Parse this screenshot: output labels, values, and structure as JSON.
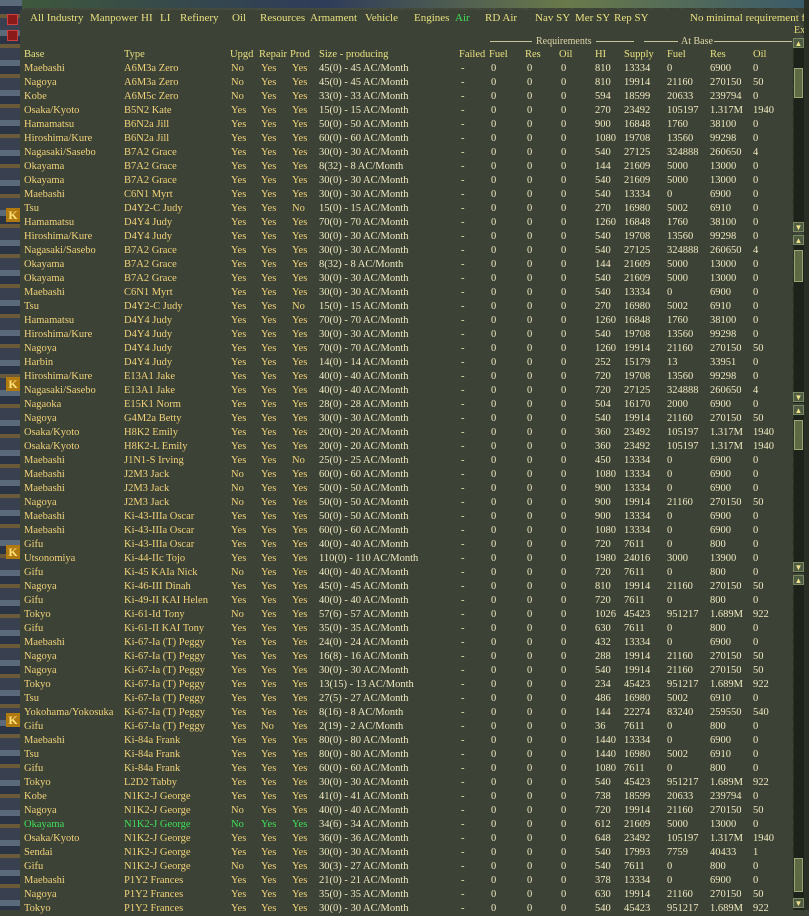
{
  "filters": [
    {
      "label": "All Industry",
      "active": false
    },
    {
      "label": "Manpower",
      "active": false
    },
    {
      "label": "HI",
      "active": false
    },
    {
      "label": "LI",
      "active": false
    },
    {
      "label": "Refinery",
      "active": false
    },
    {
      "label": "Oil",
      "active": false
    },
    {
      "label": "Resources",
      "active": false
    },
    {
      "label": "Armament",
      "active": false
    },
    {
      "label": "Vehicle",
      "active": false
    },
    {
      "label": "Engines",
      "active": false
    },
    {
      "label": "Air",
      "active": true
    },
    {
      "label": "RD Air",
      "active": false
    },
    {
      "label": "Nav SY",
      "active": false
    },
    {
      "label": "Mer SY",
      "active": false
    },
    {
      "label": "Rep SY",
      "active": false
    },
    {
      "label": "No minimal requirement fil",
      "active": false
    }
  ],
  "corner_label": "Ex",
  "group_headers": {
    "requirements": "Requirements",
    "at_base": "At Base"
  },
  "columns": [
    "Base",
    "Type",
    "Upgd",
    "Repair",
    "Prod",
    "Size - producing",
    "Failed",
    "Fuel",
    "Res",
    "Oil",
    "HI",
    "Supply",
    "Fuel",
    "Res",
    "Oil"
  ],
  "rows": [
    [
      "Maebashi",
      "A6M3a Zero",
      "No",
      "Yes",
      "Yes",
      "45(0) - 45 AC/Month",
      "-",
      "0",
      "0",
      "0",
      "810",
      "13334",
      "0",
      "6900",
      "0"
    ],
    [
      "Nagoya",
      "A6M3a Zero",
      "No",
      "Yes",
      "Yes",
      "45(0) - 45 AC/Month",
      "-",
      "0",
      "0",
      "0",
      "810",
      "19914",
      "21160",
      "270150",
      "50"
    ],
    [
      "Kobe",
      "A6M5c Zero",
      "No",
      "Yes",
      "Yes",
      "33(0) - 33 AC/Month",
      "-",
      "0",
      "0",
      "0",
      "594",
      "18599",
      "20633",
      "239794",
      "0"
    ],
    [
      "Osaka/Kyoto",
      "B5N2 Kate",
      "Yes",
      "Yes",
      "Yes",
      "15(0) - 15 AC/Month",
      "-",
      "0",
      "0",
      "0",
      "270",
      "23492",
      "105197",
      "1.317M",
      "1940"
    ],
    [
      "Hamamatsu",
      "B6N2a Jill",
      "Yes",
      "Yes",
      "Yes",
      "50(0) - 50 AC/Month",
      "-",
      "0",
      "0",
      "0",
      "900",
      "16848",
      "1760",
      "38100",
      "0"
    ],
    [
      "Hiroshima/Kure",
      "B6N2a Jill",
      "Yes",
      "Yes",
      "Yes",
      "60(0) - 60 AC/Month",
      "-",
      "0",
      "0",
      "0",
      "1080",
      "19708",
      "13560",
      "99298",
      "0"
    ],
    [
      "Nagasaki/Sasebo",
      "B7A2 Grace",
      "Yes",
      "Yes",
      "Yes",
      "30(0) - 30 AC/Month",
      "-",
      "0",
      "0",
      "0",
      "540",
      "27125",
      "324888",
      "260650",
      "4"
    ],
    [
      "Okayama",
      "B7A2 Grace",
      "Yes",
      "Yes",
      "Yes",
      "8(32) - 8 AC/Month",
      "-",
      "0",
      "0",
      "0",
      "144",
      "21609",
      "5000",
      "13000",
      "0"
    ],
    [
      "Okayama",
      "B7A2 Grace",
      "Yes",
      "Yes",
      "Yes",
      "30(0) - 30 AC/Month",
      "-",
      "0",
      "0",
      "0",
      "540",
      "21609",
      "5000",
      "13000",
      "0"
    ],
    [
      "Maebashi",
      "C6N1 Myrt",
      "Yes",
      "Yes",
      "Yes",
      "30(0) - 30 AC/Month",
      "-",
      "0",
      "0",
      "0",
      "540",
      "13334",
      "0",
      "6900",
      "0"
    ],
    [
      "Tsu",
      "D4Y2-C Judy",
      "Yes",
      "Yes",
      "No",
      "15(0) - 15 AC/Month",
      "-",
      "0",
      "0",
      "0",
      "270",
      "16980",
      "5002",
      "6910",
      "0"
    ],
    [
      "Hamamatsu",
      "D4Y4 Judy",
      "Yes",
      "Yes",
      "Yes",
      "70(0) - 70 AC/Month",
      "-",
      "0",
      "0",
      "0",
      "1260",
      "16848",
      "1760",
      "38100",
      "0"
    ],
    [
      "Hiroshima/Kure",
      "D4Y4 Judy",
      "Yes",
      "Yes",
      "Yes",
      "30(0) - 30 AC/Month",
      "-",
      "0",
      "0",
      "0",
      "540",
      "19708",
      "13560",
      "99298",
      "0"
    ],
    [
      "Nagasaki/Sasebo",
      "B7A2 Grace",
      "Yes",
      "Yes",
      "Yes",
      "30(0) - 30 AC/Month",
      "-",
      "0",
      "0",
      "0",
      "540",
      "27125",
      "324888",
      "260650",
      "4"
    ],
    [
      "Okayama",
      "B7A2 Grace",
      "Yes",
      "Yes",
      "Yes",
      "8(32) - 8 AC/Month",
      "-",
      "0",
      "0",
      "0",
      "144",
      "21609",
      "5000",
      "13000",
      "0"
    ],
    [
      "Okayama",
      "B7A2 Grace",
      "Yes",
      "Yes",
      "Yes",
      "30(0) - 30 AC/Month",
      "-",
      "0",
      "0",
      "0",
      "540",
      "21609",
      "5000",
      "13000",
      "0"
    ],
    [
      "Maebashi",
      "C6N1 Myrt",
      "Yes",
      "Yes",
      "Yes",
      "30(0) - 30 AC/Month",
      "-",
      "0",
      "0",
      "0",
      "540",
      "13334",
      "0",
      "6900",
      "0"
    ],
    [
      "Tsu",
      "D4Y2-C Judy",
      "Yes",
      "Yes",
      "No",
      "15(0) - 15 AC/Month",
      "-",
      "0",
      "0",
      "0",
      "270",
      "16980",
      "5002",
      "6910",
      "0"
    ],
    [
      "Hamamatsu",
      "D4Y4 Judy",
      "Yes",
      "Yes",
      "Yes",
      "70(0) - 70 AC/Month",
      "-",
      "0",
      "0",
      "0",
      "1260",
      "16848",
      "1760",
      "38100",
      "0"
    ],
    [
      "Hiroshima/Kure",
      "D4Y4 Judy",
      "Yes",
      "Yes",
      "Yes",
      "30(0) - 30 AC/Month",
      "-",
      "0",
      "0",
      "0",
      "540",
      "19708",
      "13560",
      "99298",
      "0"
    ],
    [
      "Nagoya",
      "D4Y4 Judy",
      "Yes",
      "Yes",
      "Yes",
      "70(0) - 70 AC/Month",
      "-",
      "0",
      "0",
      "0",
      "1260",
      "19914",
      "21160",
      "270150",
      "50"
    ],
    [
      "Harbin",
      "D4Y4 Judy",
      "Yes",
      "Yes",
      "Yes",
      "14(0) - 14 AC/Month",
      "-",
      "0",
      "0",
      "0",
      "252",
      "15179",
      "13",
      "33951",
      "0"
    ],
    [
      "Hiroshima/Kure",
      "E13A1 Jake",
      "Yes",
      "Yes",
      "Yes",
      "40(0) - 40 AC/Month",
      "-",
      "0",
      "0",
      "0",
      "720",
      "19708",
      "13560",
      "99298",
      "0"
    ],
    [
      "Nagasaki/Sasebo",
      "E13A1 Jake",
      "Yes",
      "Yes",
      "Yes",
      "40(0) - 40 AC/Month",
      "-",
      "0",
      "0",
      "0",
      "720",
      "27125",
      "324888",
      "260650",
      "4"
    ],
    [
      "Nagaoka",
      "E15K1 Norm",
      "Yes",
      "Yes",
      "Yes",
      "28(0) - 28 AC/Month",
      "-",
      "0",
      "0",
      "0",
      "504",
      "16170",
      "2000",
      "6900",
      "0"
    ],
    [
      "Nagoya",
      "G4M2a Betty",
      "Yes",
      "Yes",
      "Yes",
      "30(0) - 30 AC/Month",
      "-",
      "0",
      "0",
      "0",
      "540",
      "19914",
      "21160",
      "270150",
      "50"
    ],
    [
      "Osaka/Kyoto",
      "H8K2 Emily",
      "Yes",
      "Yes",
      "Yes",
      "20(0) - 20 AC/Month",
      "-",
      "0",
      "0",
      "0",
      "360",
      "23492",
      "105197",
      "1.317M",
      "1940"
    ],
    [
      "Osaka/Kyoto",
      "H8K2-L Emily",
      "Yes",
      "Yes",
      "Yes",
      "20(0) - 20 AC/Month",
      "-",
      "0",
      "0",
      "0",
      "360",
      "23492",
      "105197",
      "1.317M",
      "1940"
    ],
    [
      "Maebashi",
      "J1N1-S Irving",
      "Yes",
      "Yes",
      "No",
      "25(0) - 25 AC/Month",
      "-",
      "0",
      "0",
      "0",
      "450",
      "13334",
      "0",
      "6900",
      "0"
    ],
    [
      "Maebashi",
      "J2M3 Jack",
      "No",
      "Yes",
      "Yes",
      "60(0) - 60 AC/Month",
      "-",
      "0",
      "0",
      "0",
      "1080",
      "13334",
      "0",
      "6900",
      "0"
    ],
    [
      "Maebashi",
      "J2M3 Jack",
      "No",
      "Yes",
      "Yes",
      "50(0) - 50 AC/Month",
      "-",
      "0",
      "0",
      "0",
      "900",
      "13334",
      "0",
      "6900",
      "0"
    ],
    [
      "Nagoya",
      "J2M3 Jack",
      "No",
      "Yes",
      "Yes",
      "50(0) - 50 AC/Month",
      "-",
      "0",
      "0",
      "0",
      "900",
      "19914",
      "21160",
      "270150",
      "50"
    ],
    [
      "Maebashi",
      "Ki-43-IIIa Oscar",
      "Yes",
      "Yes",
      "Yes",
      "50(0) - 50 AC/Month",
      "-",
      "0",
      "0",
      "0",
      "900",
      "13334",
      "0",
      "6900",
      "0"
    ],
    [
      "Maebashi",
      "Ki-43-IIIa Oscar",
      "Yes",
      "Yes",
      "Yes",
      "60(0) - 60 AC/Month",
      "-",
      "0",
      "0",
      "0",
      "1080",
      "13334",
      "0",
      "6900",
      "0"
    ],
    [
      "Gifu",
      "Ki-43-IIIa Oscar",
      "Yes",
      "Yes",
      "Yes",
      "40(0) - 40 AC/Month",
      "-",
      "0",
      "0",
      "0",
      "720",
      "7611",
      "0",
      "800",
      "0"
    ],
    [
      "Utsonomiya",
      "Ki-44-IIc Tojo",
      "Yes",
      "Yes",
      "Yes",
      "110(0) - 110 AC/Month",
      "-",
      "0",
      "0",
      "0",
      "1980",
      "24016",
      "3000",
      "13900",
      "0"
    ],
    [
      "Gifu",
      "Ki-45 KAIa Nick",
      "No",
      "Yes",
      "Yes",
      "40(0) - 40 AC/Month",
      "-",
      "0",
      "0",
      "0",
      "720",
      "7611",
      "0",
      "800",
      "0"
    ],
    [
      "Nagoya",
      "Ki-46-III Dinah",
      "Yes",
      "Yes",
      "Yes",
      "45(0) - 45 AC/Month",
      "-",
      "0",
      "0",
      "0",
      "810",
      "19914",
      "21160",
      "270150",
      "50"
    ],
    [
      "Gifu",
      "Ki-49-II KAI Helen",
      "Yes",
      "Yes",
      "Yes",
      "40(0) - 40 AC/Month",
      "-",
      "0",
      "0",
      "0",
      "720",
      "7611",
      "0",
      "800",
      "0"
    ],
    [
      "Tokyo",
      "Ki-61-Id Tony",
      "No",
      "Yes",
      "Yes",
      "57(6) - 57 AC/Month",
      "-",
      "0",
      "0",
      "0",
      "1026",
      "45423",
      "951217",
      "1.689M",
      "922"
    ],
    [
      "Gifu",
      "Ki-61-II KAI Tony",
      "Yes",
      "Yes",
      "Yes",
      "35(0) - 35 AC/Month",
      "-",
      "0",
      "0",
      "0",
      "630",
      "7611",
      "0",
      "800",
      "0"
    ],
    [
      "Maebashi",
      "Ki-67-Ia (T) Peggy",
      "Yes",
      "Yes",
      "Yes",
      "24(0) - 24 AC/Month",
      "-",
      "0",
      "0",
      "0",
      "432",
      "13334",
      "0",
      "6900",
      "0"
    ],
    [
      "Nagoya",
      "Ki-67-Ia (T) Peggy",
      "Yes",
      "Yes",
      "Yes",
      "16(8) - 16 AC/Month",
      "-",
      "0",
      "0",
      "0",
      "288",
      "19914",
      "21160",
      "270150",
      "50"
    ],
    [
      "Nagoya",
      "Ki-67-Ia (T) Peggy",
      "Yes",
      "Yes",
      "Yes",
      "30(0) - 30 AC/Month",
      "-",
      "0",
      "0",
      "0",
      "540",
      "19914",
      "21160",
      "270150",
      "50"
    ],
    [
      "Tokyo",
      "Ki-67-Ia (T) Peggy",
      "Yes",
      "Yes",
      "Yes",
      "13(15) - 13 AC/Month",
      "-",
      "0",
      "0",
      "0",
      "234",
      "45423",
      "951217",
      "1.689M",
      "922"
    ],
    [
      "Tsu",
      "Ki-67-Ia (T) Peggy",
      "Yes",
      "Yes",
      "Yes",
      "27(5) - 27 AC/Month",
      "-",
      "0",
      "0",
      "0",
      "486",
      "16980",
      "5002",
      "6910",
      "0"
    ],
    [
      "Yokohama/Yokosuka",
      "Ki-67-Ia (T) Peggy",
      "Yes",
      "Yes",
      "Yes",
      "8(16) - 8 AC/Month",
      "-",
      "0",
      "0",
      "0",
      "144",
      "22274",
      "83240",
      "259550",
      "540"
    ],
    [
      "Gifu",
      "Ki-67-Ia (T) Peggy",
      "Yes",
      "No",
      "Yes",
      "2(19) - 2 AC/Month",
      "-",
      "0",
      "0",
      "0",
      "36",
      "7611",
      "0",
      "800",
      "0"
    ],
    [
      "Maebashi",
      "Ki-84a Frank",
      "Yes",
      "Yes",
      "Yes",
      "80(0) - 80 AC/Month",
      "-",
      "0",
      "0",
      "0",
      "1440",
      "13334",
      "0",
      "6900",
      "0"
    ],
    [
      "Tsu",
      "Ki-84a Frank",
      "Yes",
      "Yes",
      "Yes",
      "80(0) - 80 AC/Month",
      "-",
      "0",
      "0",
      "0",
      "1440",
      "16980",
      "5002",
      "6910",
      "0"
    ],
    [
      "Gifu",
      "Ki-84a Frank",
      "Yes",
      "Yes",
      "Yes",
      "60(0) - 60 AC/Month",
      "-",
      "0",
      "0",
      "0",
      "1080",
      "7611",
      "0",
      "800",
      "0"
    ],
    [
      "Tokyo",
      "L2D2 Tabby",
      "Yes",
      "Yes",
      "Yes",
      "30(0) - 30 AC/Month",
      "-",
      "0",
      "0",
      "0",
      "540",
      "45423",
      "951217",
      "1.689M",
      "922"
    ],
    [
      "Kobe",
      "N1K2-J George",
      "Yes",
      "Yes",
      "Yes",
      "41(0) - 41 AC/Month",
      "-",
      "0",
      "0",
      "0",
      "738",
      "18599",
      "20633",
      "239794",
      "0"
    ],
    [
      "Nagoya",
      "N1K2-J George",
      "No",
      "Yes",
      "Yes",
      "40(0) - 40 AC/Month",
      "-",
      "0",
      "0",
      "0",
      "720",
      "19914",
      "21160",
      "270150",
      "50"
    ],
    [
      "Okayama",
      "N1K2-J George",
      "No",
      "Yes",
      "Yes",
      "34(6) - 34 AC/Month",
      "-",
      "0",
      "0",
      "0",
      "612",
      "21609",
      "5000",
      "13000",
      "0"
    ],
    [
      "Osaka/Kyoto",
      "N1K2-J George",
      "Yes",
      "Yes",
      "Yes",
      "36(0) - 36 AC/Month",
      "-",
      "0",
      "0",
      "0",
      "648",
      "23492",
      "105197",
      "1.317M",
      "1940"
    ],
    [
      "Sendai",
      "N1K2-J George",
      "Yes",
      "Yes",
      "Yes",
      "30(0) - 30 AC/Month",
      "-",
      "0",
      "0",
      "0",
      "540",
      "17993",
      "7759",
      "40433",
      "1"
    ],
    [
      "Gifu",
      "N1K2-J George",
      "No",
      "Yes",
      "Yes",
      "30(3) - 27 AC/Month",
      "-",
      "0",
      "0",
      "0",
      "540",
      "7611",
      "0",
      "800",
      "0"
    ],
    [
      "Maebashi",
      "P1Y2 Frances",
      "Yes",
      "Yes",
      "Yes",
      "21(0) - 21 AC/Month",
      "-",
      "0",
      "0",
      "0",
      "378",
      "13334",
      "0",
      "6900",
      "0"
    ],
    [
      "Nagoya",
      "P1Y2 Frances",
      "Yes",
      "Yes",
      "Yes",
      "35(0) - 35 AC/Month",
      "-",
      "0",
      "0",
      "0",
      "630",
      "19914",
      "21160",
      "270150",
      "50"
    ],
    [
      "Tokyo",
      "P1Y2 Frances",
      "Yes",
      "Yes",
      "Yes",
      "30(0) - 30 AC/Month",
      "-",
      "0",
      "0",
      "0",
      "540",
      "45423",
      "951217",
      "1.689M",
      "922"
    ]
  ],
  "highlighted_row": 54,
  "colors": {
    "header_text": "#e8e080",
    "cell_text": "#f0e8c0",
    "base_text": "#f2d27a",
    "active_filter": "#3fe05a",
    "highlight_row": "#3fe05a"
  }
}
